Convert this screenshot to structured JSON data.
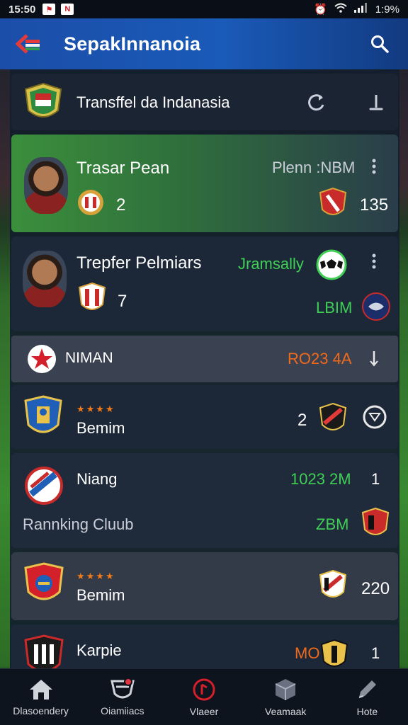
{
  "status_bar": {
    "time": "15:50",
    "battery": "1:9%"
  },
  "app_bar": {
    "title": "SepakInnanoia"
  },
  "header_row": {
    "title": "Transffel da Indanasia"
  },
  "players": [
    {
      "name": "Trasar Pean",
      "number": "2",
      "status": "Plenn :NBM",
      "value": "135"
    },
    {
      "name": "Trepfer Pelmiars",
      "number": "7",
      "status": "Jramsally",
      "value": "LBIM"
    }
  ],
  "section": {
    "label": "NIMAN",
    "value": "RO23 4A"
  },
  "clubs": [
    {
      "stars": "★★★★",
      "name": "Bemim",
      "number": "2"
    },
    {
      "name": "Niang",
      "value": "1023 2M",
      "number": "1",
      "subtitle": "Rannking Cluub",
      "subvalue": "ZBM"
    },
    {
      "stars": "★★★★",
      "name": "Bemim",
      "value": "220"
    },
    {
      "name": "Karpie",
      "value": "MO",
      "number": "1"
    }
  ],
  "bottom_nav": [
    {
      "label": "Dlasoendery",
      "icon": "home-icon"
    },
    {
      "label": "Oiamiiacs",
      "icon": "shield-icon"
    },
    {
      "label": "Vlaeer",
      "icon": "record-icon"
    },
    {
      "label": "Veamaak",
      "icon": "cube-icon"
    },
    {
      "label": "Hote",
      "icon": "pencil-icon"
    }
  ],
  "colors": {
    "accent_green": "#3fcf55",
    "accent_orange": "#f06a1c",
    "app_bar_blue": "#1b4ea8"
  }
}
